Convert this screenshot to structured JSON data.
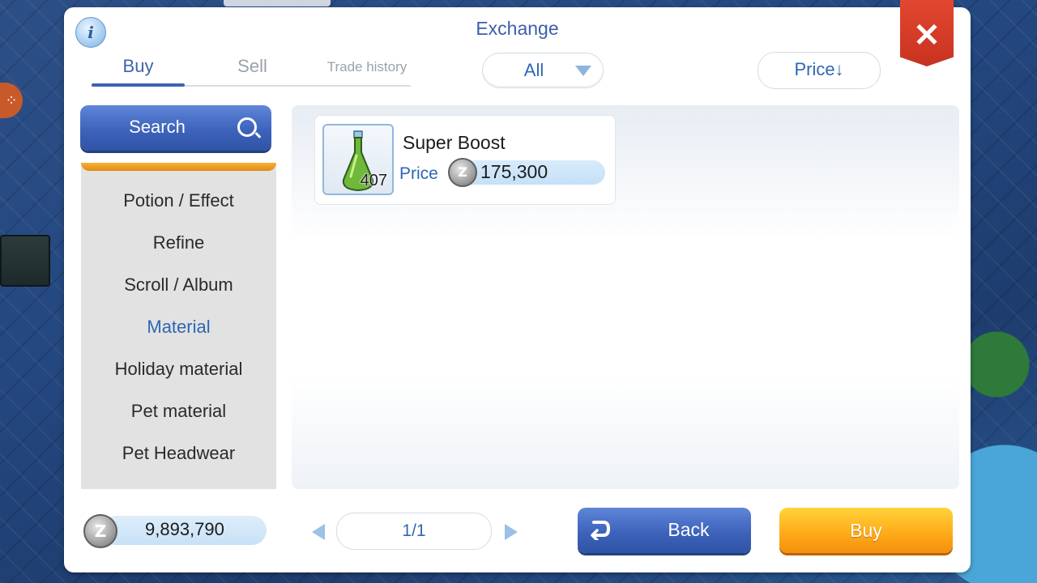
{
  "window": {
    "title": "Exchange"
  },
  "tabs": [
    {
      "label": "Buy",
      "active": true
    },
    {
      "label": "Sell",
      "active": false
    },
    {
      "label": "Trade history",
      "active": false
    }
  ],
  "filter": {
    "selected": "All"
  },
  "sort": {
    "label": "Price↓"
  },
  "sidebar": {
    "search_label": "Search",
    "categories": [
      {
        "label": "Potion / Effect",
        "active": false
      },
      {
        "label": "Refine",
        "active": false
      },
      {
        "label": "Scroll / Album",
        "active": false
      },
      {
        "label": "Material",
        "active": true
      },
      {
        "label": "Holiday material",
        "active": false
      },
      {
        "label": "Pet material",
        "active": false
      },
      {
        "label": "Pet Headwear",
        "active": false
      }
    ]
  },
  "listings": [
    {
      "name": "Super Boost",
      "quantity": "407",
      "price_label": "Price",
      "price": "175,300",
      "icon": "green-potion-icon"
    }
  ],
  "currency": {
    "symbol": "Z",
    "balance": "9,893,790"
  },
  "pager": {
    "text": "1/1"
  },
  "actions": {
    "back_label": "Back",
    "buy_label": "Buy"
  },
  "colors": {
    "accent_blue": "#3e63b0",
    "buy_orange": "#ffac1a",
    "close_red": "#d83a26",
    "active_category": "#2f67b3"
  }
}
